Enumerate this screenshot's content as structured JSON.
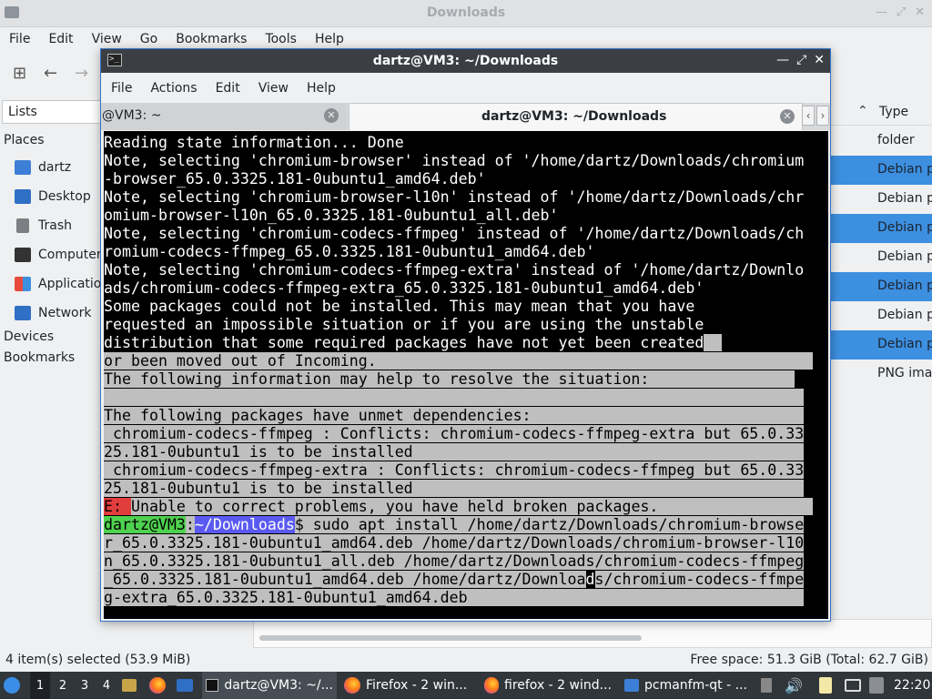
{
  "file_manager": {
    "title": "Downloads",
    "menu": [
      "File",
      "Edit",
      "View",
      "Go",
      "Bookmarks",
      "Tools",
      "Help"
    ],
    "lists_label": "Lists",
    "places_heading": "Places",
    "places": [
      "dartz",
      "Desktop",
      "Trash",
      "Computer",
      "Applications",
      "Network"
    ],
    "devices_heading": "Devices",
    "bookmarks_heading": "Bookmarks",
    "type_column": "Type",
    "type_values": [
      "folder",
      "Debian p",
      "Debian p",
      "Debian p",
      "Debian p",
      "Debian p",
      "Debian p",
      "Debian p",
      "PNG ima"
    ],
    "status_left": "4 item(s) selected (53.9 MiB)",
    "status_right": "Free space: 51.3 GiB (Total: 62.7 GiB)"
  },
  "terminal": {
    "title": "dartz@VM3: ~/Downloads",
    "menu": [
      "File",
      "Actions",
      "Edit",
      "View",
      "Help"
    ],
    "tabs": [
      "@VM3: ~",
      "dartz@VM3: ~/Downloads"
    ],
    "lines": {
      "l1": "Reading state information... Done",
      "l2": "Note, selecting 'chromium-browser' instead of '/home/dartz/Downloads/chromium",
      "l3": "-browser_65.0.3325.181-0ubuntu1_amd64.deb'",
      "l4": "Note, selecting 'chromium-browser-l10n' instead of '/home/dartz/Downloads/chr",
      "l5": "omium-browser-l10n_65.0.3325.181-0ubuntu1_all.deb'",
      "l6": "Note, selecting 'chromium-codecs-ffmpeg' instead of '/home/dartz/Downloads/ch",
      "l7": "romium-codecs-ffmpeg_65.0.3325.181-0ubuntu1_amd64.deb'",
      "l8": "Note, selecting 'chromium-codecs-ffmpeg-extra' instead of '/home/dartz/Downlo",
      "l9": "ads/chromium-codecs-ffmpeg-extra_65.0.3325.181-0ubuntu1_amd64.deb'",
      "l10": "Some packages could not be installed. This may mean that you have",
      "l11": "requested an impossible situation or if you are using the unstable",
      "l12": "distribution that some required packages have not yet been created",
      "l13": "or been moved out of Incoming.",
      "l14": "The following information may help to resolve the situation:",
      "l15": "",
      "l16": "The following packages have unmet dependencies:",
      "l17": " chromium-codecs-ffmpeg : Conflicts: chromium-codecs-ffmpeg-extra but 65.0.33",
      "l18": "25.181-0ubuntu1 is to be installed",
      "l19": " chromium-codecs-ffmpeg-extra : Conflicts: chromium-codecs-ffmpeg but 65.0.33",
      "l20": "25.181-0ubuntu1 is to be installed",
      "l21_tag": "E: ",
      "l21": "Unable to correct problems, you have held broken packages.",
      "prompt_user": "dartz@VM3",
      "prompt_sep": ":",
      "prompt_path": "~/Downloads",
      "l22": "$ sudo apt install /home/dartz/Downloads/chromium-browse",
      "l23": "r_65.0.3325.181-0ubuntu1_amd64.deb /home/dartz/Downloads/chromium-browser-l10",
      "l24": "n_65.0.3325.181-0ubuntu1_all.deb /home/dartz/Downloads/chromium-codecs-ffmpeg",
      "l25a": "_65.0.3325.181-0ubuntu1_amd64.deb /home/dartz/Downloa",
      "l25b": "d",
      "l25c": "s/chromium-codecs-ffmpe",
      "l26": "g-extra_65.0.3325.181-0ubuntu1_amd64.deb"
    }
  },
  "taskbar": {
    "workspaces": [
      "1",
      "2",
      "3",
      "4"
    ],
    "tasks": [
      "dartz@VM3: ~/...",
      "Firefox - 2 win...",
      "firefox - 2 wind...",
      "pcmanfm-qt - ..."
    ],
    "clock": "22:20"
  }
}
